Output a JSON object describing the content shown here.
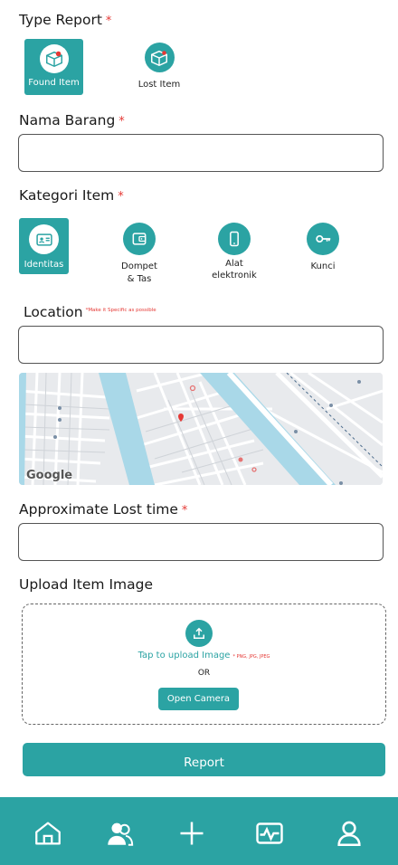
{
  "type_report": {
    "label": "Type Report",
    "required": "*",
    "options": [
      {
        "label": "Found Item",
        "icon": "found-item-box-icon",
        "active": true
      },
      {
        "label": "Lost Item",
        "icon": "lost-item-box-icon",
        "active": false
      }
    ]
  },
  "nama_barang": {
    "label": "Nama Barang",
    "required": "*",
    "value": ""
  },
  "kategori": {
    "label": "Kategori Item",
    "required": "*",
    "items": [
      {
        "line1": "Identitas",
        "line2": "",
        "icon": "id-card-icon",
        "active": true
      },
      {
        "line1": "Dompet",
        "line2": "& Tas",
        "icon": "wallet-icon",
        "active": false
      },
      {
        "line1": "Alat",
        "line2": "elektronik",
        "icon": "phone-icon",
        "active": false
      },
      {
        "line1": "Kunci",
        "line2": "",
        "icon": "key-icon",
        "active": false
      }
    ]
  },
  "location": {
    "label": "Location",
    "hint": "*Make it Specific as possible",
    "value": ""
  },
  "map": {
    "attribution": "Google"
  },
  "lost_time": {
    "label": "Approximate Lost time",
    "required": "*",
    "value": ""
  },
  "upload": {
    "label": "Upload Item Image",
    "tap_text": "Tap to upload Image",
    "formats": "* PNG, JPG, JPEG",
    "or_text": "OR",
    "camera_button": "Open Camera"
  },
  "submit_button": "Report",
  "bottom_nav": [
    {
      "name": "home-icon"
    },
    {
      "name": "users-icon"
    },
    {
      "name": "plus-icon"
    },
    {
      "name": "activity-icon"
    },
    {
      "name": "profile-icon"
    }
  ],
  "colors": {
    "accent": "#2ba3a3",
    "required": "#e53935",
    "water": "#a9d8e8"
  }
}
